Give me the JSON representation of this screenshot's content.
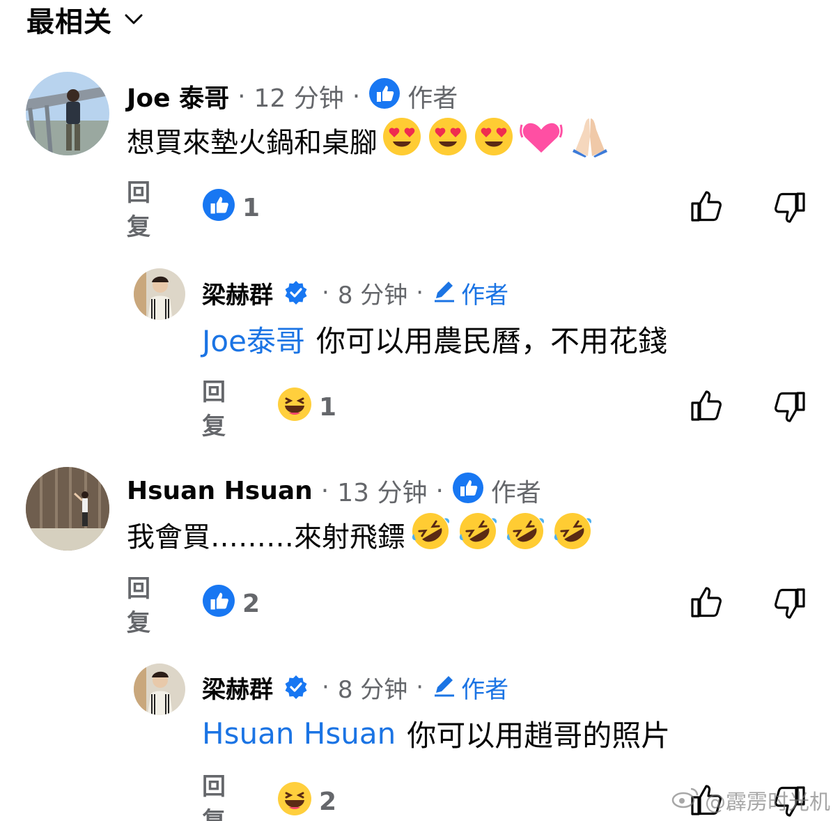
{
  "sort": {
    "label": "最相关"
  },
  "comments": [
    {
      "name": "Joe 泰哥",
      "time": "12 分钟",
      "author_label": "作者",
      "text": "想買來墊火鍋和桌腳",
      "reply_label": "回复",
      "reaction_count": "1"
    },
    {
      "name": "梁赫群",
      "time": "8 分钟",
      "author_label": "作者",
      "mention": "Joe泰哥",
      "text": "你可以用農民曆，不用花錢",
      "reply_label": "回复",
      "reaction_count": "1"
    },
    {
      "name": "Hsuan Hsuan",
      "time": "13 分钟",
      "author_label": "作者",
      "text": "我會買………來射飛鏢",
      "reply_label": "回复",
      "reaction_count": "2"
    },
    {
      "name": "梁赫群",
      "time": "8 分钟",
      "author_label": "作者",
      "mention": "Hsuan Hsuan",
      "text": "你可以用趙哥的照片",
      "reply_label": "回复",
      "reaction_count": "2"
    }
  ],
  "watermark": "@霹雳时光机",
  "colors": {
    "link_blue": "#1b74e4",
    "secondary_text": "#65676b",
    "like_blue": "#1877f2"
  }
}
